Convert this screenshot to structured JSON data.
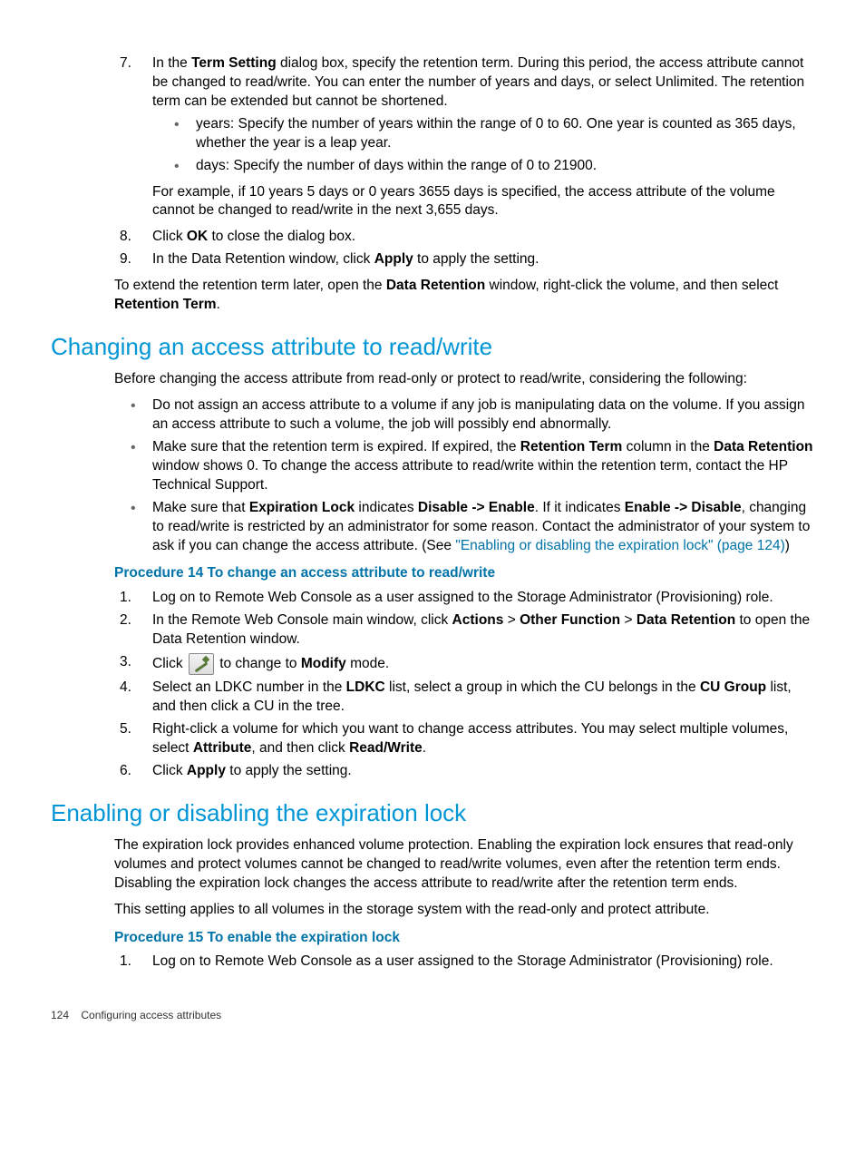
{
  "steps_top": {
    "7": {
      "intro_a": "In the ",
      "b1": "Term Setting",
      "intro_b": " dialog box, specify the retention term. During this period, the access attribute cannot be changed to read/write. You can enter the number of years and days, or select Unlimited. The retention term can be extended but cannot be shortened.",
      "bullet_years": "years: Specify the number of years within the range of 0 to 60. One year is counted as 365 days, whether the year is a leap year.",
      "bullet_days": "days: Specify the number of days within the range of 0 to 21900.",
      "example": "For example, if 10 years 5 days or 0 years 3655 days is specified, the access attribute of the volume cannot be changed to read/write in the next 3,655 days."
    },
    "8": {
      "a": "Click ",
      "b": "OK",
      "c": " to close the dialog box."
    },
    "9": {
      "a": "In the Data Retention window, click ",
      "b": "Apply",
      "c": " to apply the setting."
    }
  },
  "extend_para": {
    "a": "To extend the retention term later, open the ",
    "b1": "Data Retention",
    "b_mid": " window, right-click the volume, and then select ",
    "b2": "Retention Term",
    "c": "."
  },
  "h2_changing": "Changing an access attribute to read/write",
  "changing_intro": "Before changing the access attribute from read-only or protect to read/write, considering the following:",
  "changing_bullets": {
    "1": "Do not assign an access attribute to a volume if any job is manipulating data on the volume. If you assign an access attribute to such a volume, the job will possibly end abnormally.",
    "2": {
      "a": "Make sure that the retention term is expired. If expired, the ",
      "b1": "Retention Term",
      "mid1": " column in the ",
      "b2": "Data Retention",
      "c": " window shows 0. To change the access attribute to read/write within the retention term, contact the HP Technical Support."
    },
    "3": {
      "a": "Make sure that ",
      "b1": "Expiration Lock",
      "mid1": " indicates ",
      "b2": "Disable -> Enable",
      "mid2": ". If it indicates ",
      "b3": "Enable -> Disable",
      "c": ", changing to read/write is restricted by an administrator for some reason. Contact the administrator of your system to ask if you can change the access attribute. (See ",
      "link": "\"Enabling or disabling the expiration lock\" (page 124)",
      "d": ")"
    }
  },
  "proc14_title": "Procedure 14 To change an access attribute to read/write",
  "proc14": {
    "1": "Log on to Remote Web Console as a user assigned to the Storage Administrator (Provisioning) role.",
    "2": {
      "a": "In the Remote Web Console main window, click ",
      "b1": "Actions",
      "g1": " > ",
      "b2": "Other Function",
      "g2": " > ",
      "b3": "Data Retention",
      "c": " to open the Data Retention window."
    },
    "3": {
      "a": "Click ",
      "c": " to change to ",
      "b": "Modify",
      "d": " mode."
    },
    "4": {
      "a": "Select an LDKC number in the ",
      "b1": "LDKC",
      "mid": " list, select a group in which the CU belongs in the ",
      "b2": "CU Group",
      "c": " list, and then click a CU in the tree."
    },
    "5": {
      "a": "Right-click a volume for which you want to change access attributes. You may select multiple volumes, select ",
      "b1": "Attribute",
      "mid": ", and then click ",
      "b2": "Read/Write",
      "c": "."
    },
    "6": {
      "a": "Click ",
      "b": "Apply",
      "c": " to apply the setting."
    }
  },
  "h2_enabling": "Enabling or disabling the expiration lock",
  "enabling_p1": "The expiration lock provides enhanced volume protection. Enabling the expiration lock ensures that read-only volumes and protect volumes cannot be changed to read/write volumes, even after the retention term ends. Disabling the expiration lock changes the access attribute to read/write after the retention term ends.",
  "enabling_p2": "This setting applies to all volumes in the storage system with the read-only and protect attribute.",
  "proc15_title": "Procedure 15 To enable the expiration lock",
  "proc15": {
    "1": "Log on to Remote Web Console as a user assigned to the Storage Administrator (Provisioning) role."
  },
  "footer": {
    "page": "124",
    "section": "Configuring access attributes"
  }
}
